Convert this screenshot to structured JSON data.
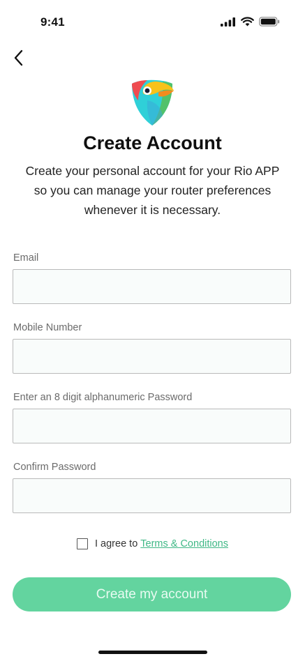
{
  "status_bar": {
    "time": "9:41",
    "icons": [
      "signal-icon",
      "wifi-icon",
      "battery-icon"
    ]
  },
  "header": {
    "back_icon": "chevron-left-icon",
    "logo": "toucan-shield-logo"
  },
  "title": "Create Account",
  "subtitle": "Create your personal account for your Rio APP so you can manage your router preferences whenever it is necessary.",
  "form": {
    "fields": [
      {
        "label": "Email",
        "value": "",
        "placeholder": ""
      },
      {
        "label": "Mobile Number",
        "value": "",
        "placeholder": ""
      },
      {
        "label": "Enter an 8 digit alphanumeric Password",
        "value": "",
        "placeholder": ""
      },
      {
        "label": "Confirm Password",
        "value": "",
        "placeholder": ""
      }
    ],
    "agree_checked": false,
    "agree_text": "I agree to",
    "terms_link": "Terms & Conditions",
    "submit_label": "Create my account"
  },
  "colors": {
    "accent": "#63d49f",
    "link": "#3fb886",
    "input_bg": "#f9fcfb",
    "input_border": "#b9b9b9"
  }
}
